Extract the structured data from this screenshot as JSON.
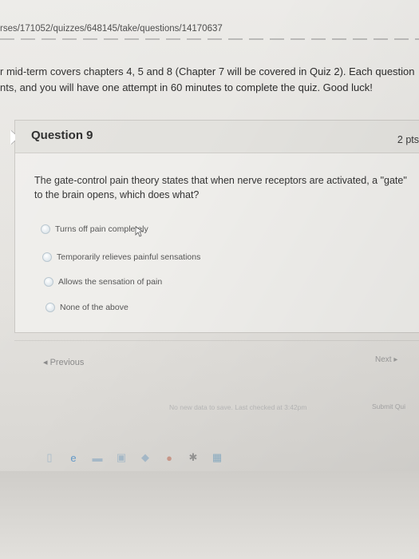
{
  "browser": {
    "url": "rses/171052/quizzes/648145/take/questions/14170637"
  },
  "intro": {
    "line1": "r mid-term covers chapters 4, 5 and 8 (Chapter 7 will be covered in Quiz 2). Each question",
    "line2": "nts, and you will have one attempt in 60 minutes to complete the quiz. Good luck!"
  },
  "question": {
    "title": "Question 9",
    "points": "2 pts",
    "text": "The gate-control pain theory states that when nerve receptors are activated, a \"gate\" to the brain opens, which does what?",
    "options": [
      "Turns off pain completely",
      "Temporarily relieves painful sensations",
      "Allows the sensation of pain",
      "None of the above"
    ]
  },
  "nav": {
    "previous": "◂ Previous",
    "next": "Next ▸"
  },
  "footer": {
    "status": "No new data to save. Last checked at 3:42pm",
    "submit": "Submit Qui"
  },
  "taskbar": {
    "icons": [
      "task-view-icon",
      "edge-icon",
      "file-explorer-icon",
      "store-icon",
      "dropbox-icon",
      "chrome-icon",
      "settings-icon",
      "app-tile-icon"
    ]
  }
}
